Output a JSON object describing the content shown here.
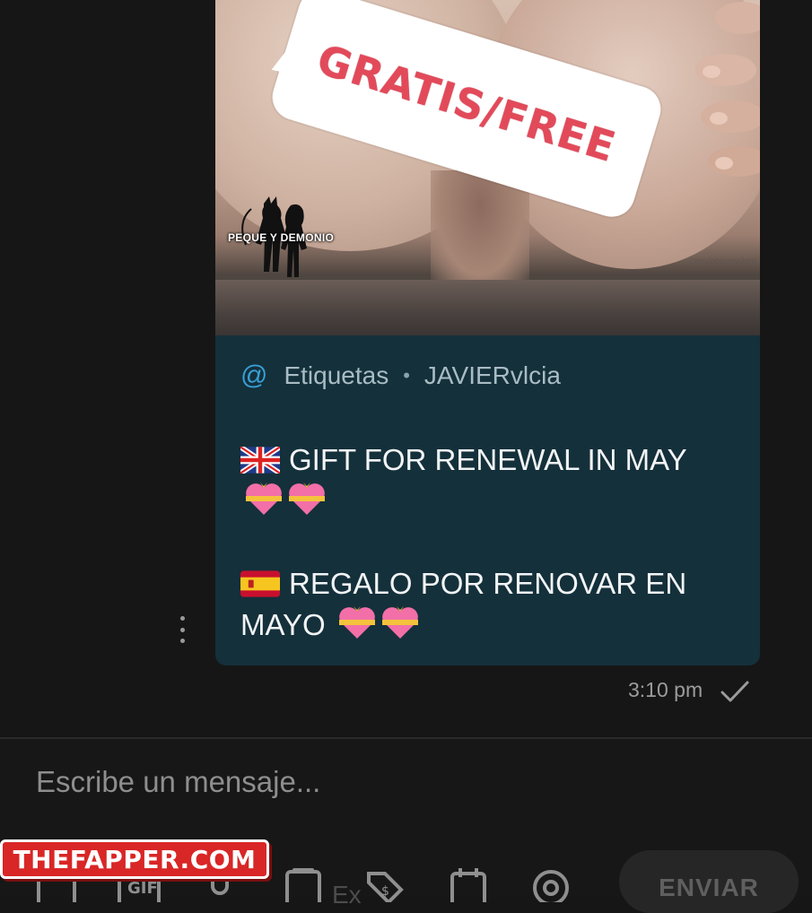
{
  "media": {
    "overlay_text": "GRATIS/FREE",
    "logo_text": "PEQUE Y DEMONIO",
    "watermark_url": ".com/pequeydem"
  },
  "message": {
    "tag_label": "Etiquetas",
    "tag_user": "JAVIERvlcia",
    "line1": "GIFT FOR RENEWAL IN MAY",
    "line2": "REGALO POR RENOVAR EN MAYO",
    "timestamp": "3:10 pm",
    "status": "sent"
  },
  "composer": {
    "placeholder": "Escribe un mensaje...",
    "send_label": "ENVIAR",
    "faded_hint": "Ex"
  },
  "site_logo": "THEFAPPER.COM",
  "colors": {
    "bubble_bg": "#14303b",
    "accent_at": "#37a0d6",
    "overlay_red": "#e24a5a",
    "logo_red": "#d92626"
  },
  "icons": [
    "at-icon",
    "uk-flag-icon",
    "spain-flag-icon",
    "gift-heart-icon",
    "check-icon",
    "kebab-icon",
    "image-icon",
    "gif-icon",
    "mic-icon",
    "gallery-icon",
    "price-tag-icon",
    "calendar-icon",
    "mention-icon"
  ]
}
